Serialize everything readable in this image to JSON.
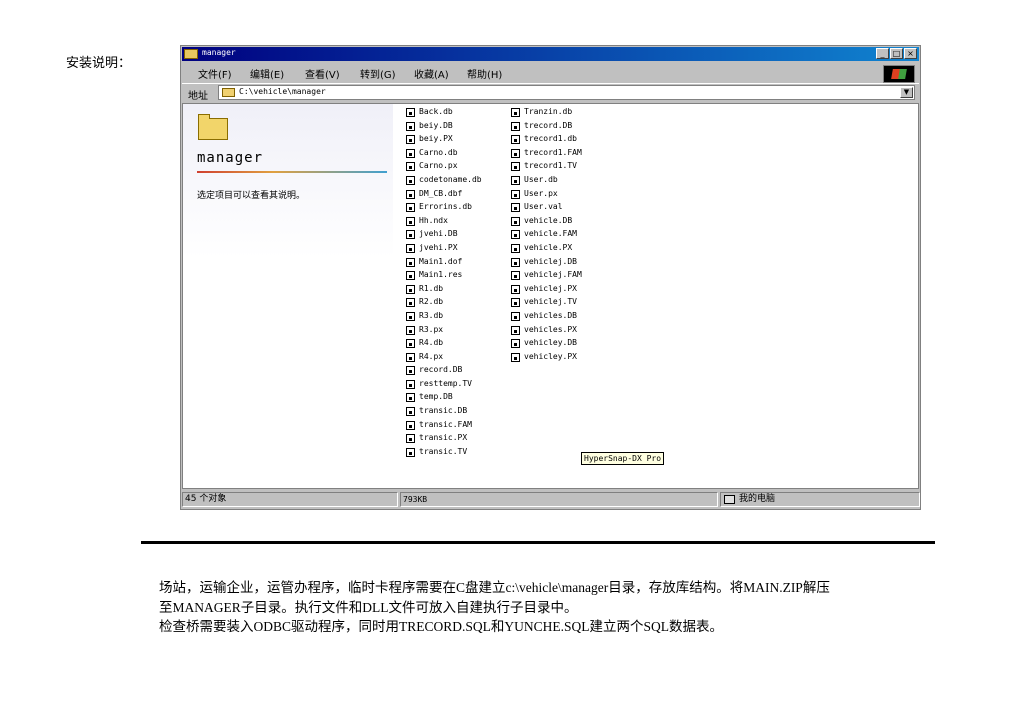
{
  "doc": {
    "label": "安装说明：",
    "paragraphs": [
      "场站，运输企业，运管办程序，临时卡程序需要在C盘建立c:\\vehicle\\manager目录，存放库结构。将MAIN.ZIP解压",
      "至MANAGER子目录。执行文件和DLL文件可放入自建执行子目录中。",
      "检查桥需要装入ODBC驱动程序，同时用TRECORD.SQL和YUNCHE.SQL建立两个SQL数据表。"
    ]
  },
  "window": {
    "title": "manager",
    "controls": {
      "minimize": "_",
      "maximize": "□",
      "close": "×"
    },
    "menu": [
      "文件(F)",
      "编辑(E)",
      "查看(V)",
      "转到(G)",
      "收藏(A)",
      "帮助(H)"
    ],
    "address": {
      "label": "地址",
      "value": "C:\\vehicle\\manager"
    },
    "left_pane": {
      "folder_name": "manager",
      "hint": "选定项目可以查看其说明。"
    },
    "files_col1": [
      "Back.db",
      "beiy.DB",
      "beiy.PX",
      "Carno.db",
      "Carno.px",
      "codetoname.db",
      "DM_CB.dbf",
      "Errorins.db",
      "Hh.ndx",
      "jvehi.DB",
      "jvehi.PX",
      "Main1.dof",
      "Main1.res",
      "R1.db",
      "R2.db",
      "R3.db",
      "R3.px",
      "R4.db",
      "R4.px",
      "record.DB",
      "resttemp.TV",
      "temp.DB",
      "transic.DB",
      "transic.FAM",
      "transic.PX",
      "transic.TV"
    ],
    "files_col2": [
      "Tranzin.db",
      "trecord.DB",
      "trecord1.db",
      "trecord1.FAM",
      "trecord1.TV",
      "User.db",
      "User.px",
      "User.val",
      "vehicle.DB",
      "vehicle.FAM",
      "vehicle.PX",
      "vehiclej.DB",
      "vehiclej.FAM",
      "vehiclej.PX",
      "vehiclej.TV",
      "vehicles.DB",
      "vehicles.PX",
      "vehicley.DB",
      "vehicley.PX"
    ],
    "status": {
      "count": "45 个对象",
      "size": "793KB",
      "location": "我的电脑"
    },
    "tooltip": "HyperSnap-DX Pro"
  }
}
